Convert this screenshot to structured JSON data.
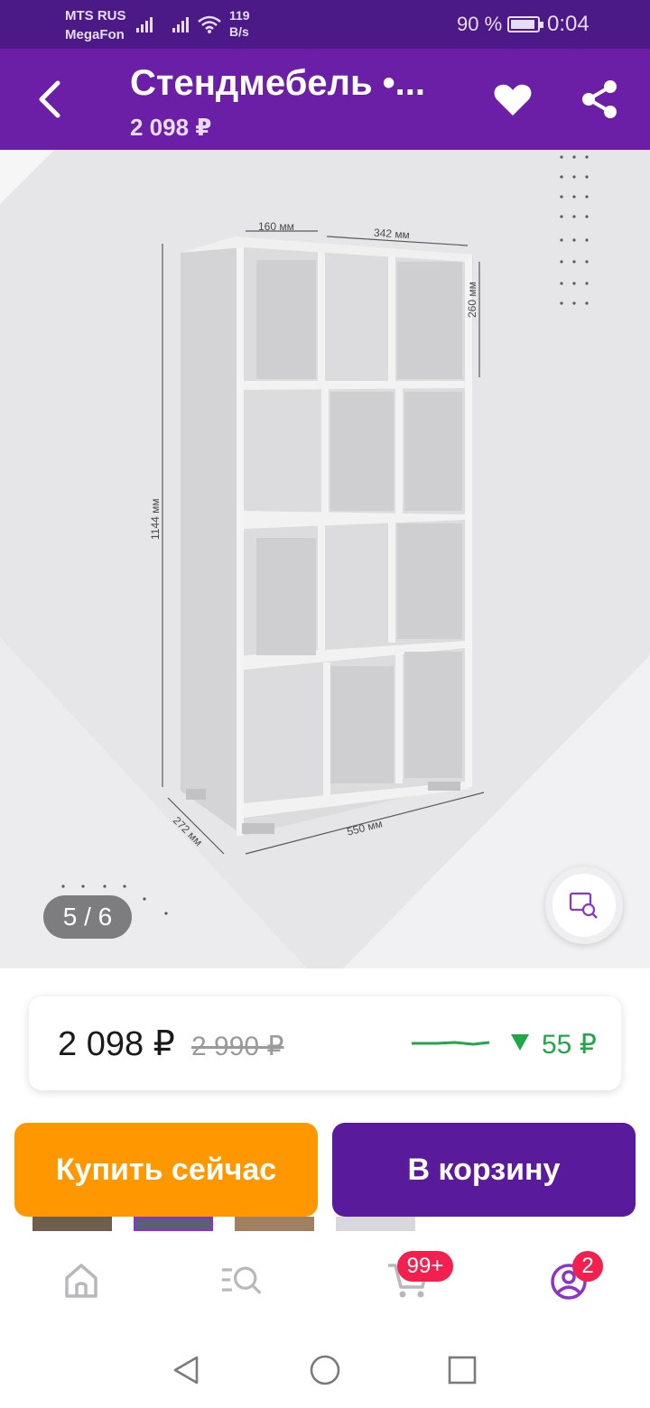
{
  "status_bar": {
    "carrier_1": "MTS RUS",
    "carrier_2": "MegaFon",
    "speed_value": "119",
    "speed_unit": "B/s",
    "battery": "90 %",
    "time": "0:04"
  },
  "header": {
    "title": "Стендмебель •...",
    "price": "2 098 ₽"
  },
  "gallery": {
    "counter": "5 / 6",
    "dimensions": {
      "width_left": "160 мм",
      "width_right": "342 мм",
      "shelf_height": "260 мм",
      "total_height": "1144 мм",
      "depth": "272 мм",
      "total_width": "550 мм"
    }
  },
  "price_card": {
    "current": "2 098 ₽",
    "old": "2 990 ₽",
    "drop": "55 ₽",
    "trend_color": "#22a748"
  },
  "buttons": {
    "buy_now": "Купить сейчас",
    "add_to_cart": "В корзину"
  },
  "bottom_nav": {
    "cart_badge": "99+",
    "profile_badge": "2",
    "accent": "#6a1fa6"
  }
}
